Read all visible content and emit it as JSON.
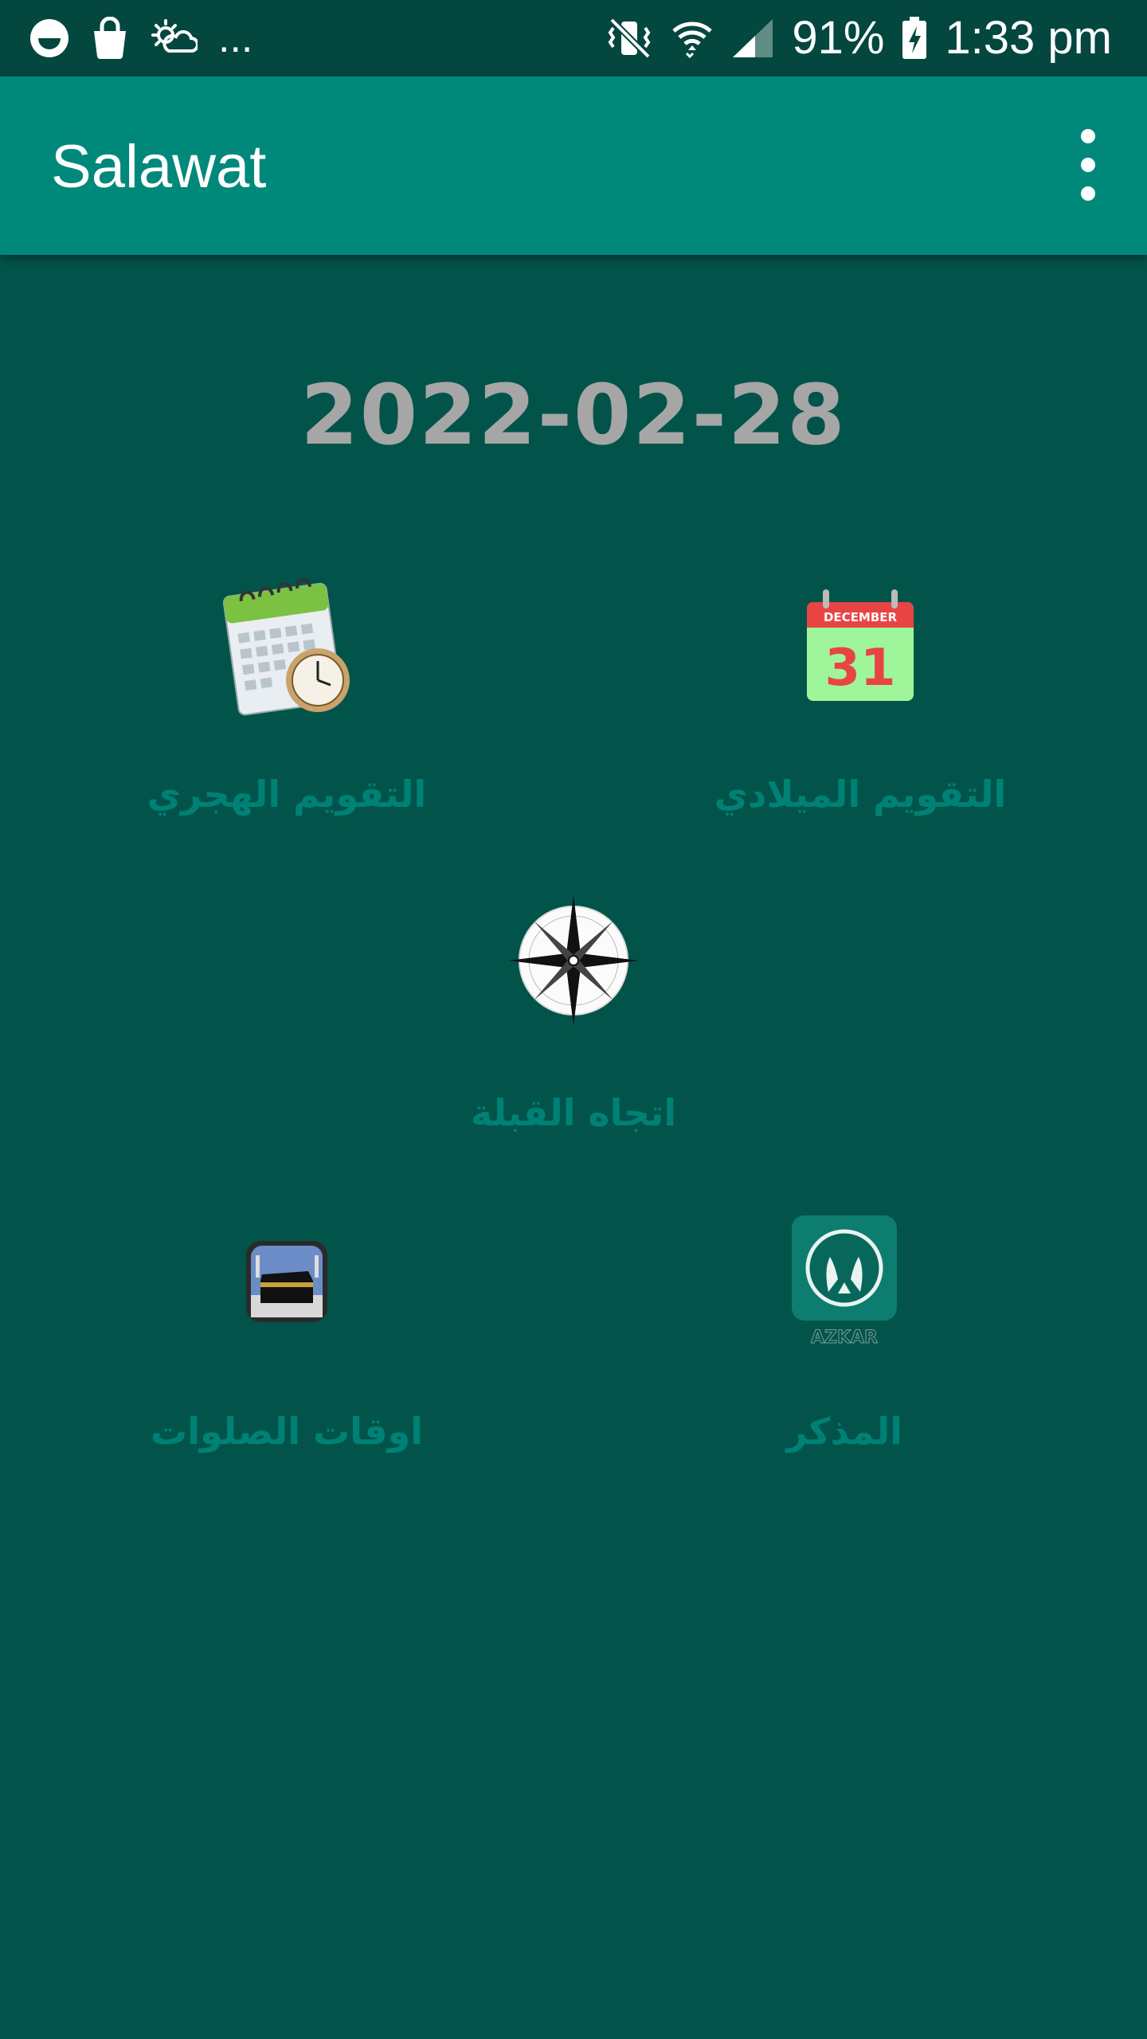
{
  "status_bar": {
    "battery": "91%",
    "time": "1:33 pm",
    "overflow": "..."
  },
  "app_bar": {
    "title": "Salawat"
  },
  "date": "2022-02-28",
  "tiles": [
    {
      "label": "التقويم الهجري",
      "icon": "hijri-calendar-icon"
    },
    {
      "label": "التقويم الميلادي",
      "icon": "gregorian-calendar-icon",
      "calendar_month": "DECEMBER",
      "calendar_day": "31"
    },
    {
      "label": "اتجاه القبلة",
      "icon": "compass-icon"
    },
    {
      "label": "اوقات الصلوات",
      "icon": "kaaba-icon"
    },
    {
      "label": "المذكر",
      "icon": "azkar-icon",
      "icon_caption": "AZKAR"
    }
  ],
  "colors": {
    "status_bar": "#03473F",
    "app_bar": "#00897B",
    "background": "#02544A",
    "date_text": "#A6A6A6",
    "tile_label": "#008175"
  }
}
